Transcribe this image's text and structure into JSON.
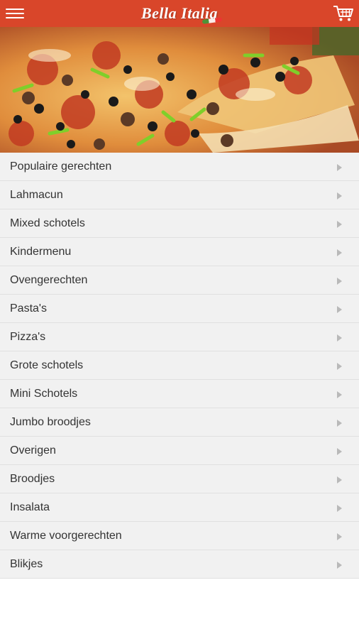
{
  "header": {
    "brand": "Bella Italia",
    "menu_icon": "hamburger-menu-icon",
    "cart_icon": "shopping-cart-icon",
    "background": "#d9462a"
  },
  "hero": {
    "image": "pizza-photo"
  },
  "categories": [
    {
      "label": "Populaire gerechten"
    },
    {
      "label": "Lahmacun"
    },
    {
      "label": "Mixed schotels"
    },
    {
      "label": "Kindermenu"
    },
    {
      "label": "Ovengerechten"
    },
    {
      "label": "Pasta's"
    },
    {
      "label": "Pizza's"
    },
    {
      "label": "Grote schotels"
    },
    {
      "label": "Mini Schotels"
    },
    {
      "label": "Jumbo broodjes"
    },
    {
      "label": "Overigen"
    },
    {
      "label": "Broodjes"
    },
    {
      "label": "Insalata"
    },
    {
      "label": "Warme voorgerechten"
    },
    {
      "label": "Blikjes"
    }
  ]
}
